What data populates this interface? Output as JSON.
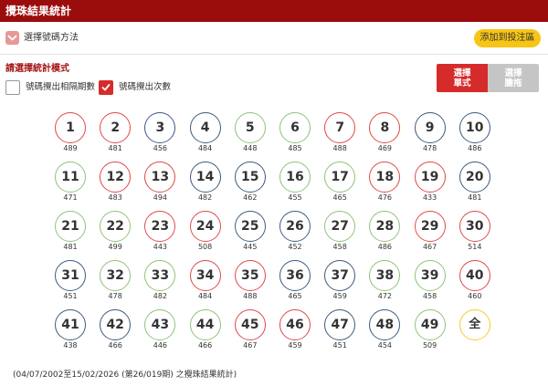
{
  "header": {
    "title": "攪珠結果統計"
  },
  "method": {
    "label": "選擇號碼方法",
    "add_button": "添加到投注區"
  },
  "mode": {
    "title": "請選擇統計模式",
    "options": [
      {
        "label": "號碼攪出相隔期數",
        "checked": false
      },
      {
        "label": "號碼攪出次數",
        "checked": true
      }
    ]
  },
  "tabs": [
    {
      "line1": "選擇",
      "line2": "單式",
      "active": true
    },
    {
      "line1": "選擇",
      "line2": "膽拖",
      "active": false
    }
  ],
  "colors": {
    "red": "#e04848",
    "blue": "#3d5a80",
    "green": "#8fc27a",
    "yellow": "#f5cc2a",
    "header": "#9b0c0c"
  },
  "balls": [
    {
      "num": "1",
      "count": "489",
      "color": "red"
    },
    {
      "num": "2",
      "count": "481",
      "color": "red"
    },
    {
      "num": "3",
      "count": "456",
      "color": "blue"
    },
    {
      "num": "4",
      "count": "484",
      "color": "blue"
    },
    {
      "num": "5",
      "count": "448",
      "color": "green"
    },
    {
      "num": "6",
      "count": "485",
      "color": "green"
    },
    {
      "num": "7",
      "count": "488",
      "color": "red"
    },
    {
      "num": "8",
      "count": "469",
      "color": "red"
    },
    {
      "num": "9",
      "count": "478",
      "color": "blue"
    },
    {
      "num": "10",
      "count": "486",
      "color": "blue"
    },
    {
      "num": "11",
      "count": "471",
      "color": "green"
    },
    {
      "num": "12",
      "count": "483",
      "color": "red"
    },
    {
      "num": "13",
      "count": "494",
      "color": "red"
    },
    {
      "num": "14",
      "count": "482",
      "color": "blue"
    },
    {
      "num": "15",
      "count": "462",
      "color": "blue"
    },
    {
      "num": "16",
      "count": "455",
      "color": "green"
    },
    {
      "num": "17",
      "count": "465",
      "color": "green"
    },
    {
      "num": "18",
      "count": "476",
      "color": "red"
    },
    {
      "num": "19",
      "count": "433",
      "color": "red"
    },
    {
      "num": "20",
      "count": "481",
      "color": "blue"
    },
    {
      "num": "21",
      "count": "481",
      "color": "green"
    },
    {
      "num": "22",
      "count": "499",
      "color": "green"
    },
    {
      "num": "23",
      "count": "443",
      "color": "red"
    },
    {
      "num": "24",
      "count": "508",
      "color": "red"
    },
    {
      "num": "25",
      "count": "445",
      "color": "blue"
    },
    {
      "num": "26",
      "count": "452",
      "color": "blue"
    },
    {
      "num": "27",
      "count": "458",
      "color": "green"
    },
    {
      "num": "28",
      "count": "486",
      "color": "green"
    },
    {
      "num": "29",
      "count": "467",
      "color": "red"
    },
    {
      "num": "30",
      "count": "514",
      "color": "red"
    },
    {
      "num": "31",
      "count": "451",
      "color": "blue"
    },
    {
      "num": "32",
      "count": "478",
      "color": "green"
    },
    {
      "num": "33",
      "count": "482",
      "color": "green"
    },
    {
      "num": "34",
      "count": "484",
      "color": "red"
    },
    {
      "num": "35",
      "count": "488",
      "color": "red"
    },
    {
      "num": "36",
      "count": "465",
      "color": "blue"
    },
    {
      "num": "37",
      "count": "459",
      "color": "blue"
    },
    {
      "num": "38",
      "count": "472",
      "color": "green"
    },
    {
      "num": "39",
      "count": "458",
      "color": "green"
    },
    {
      "num": "40",
      "count": "460",
      "color": "red"
    },
    {
      "num": "41",
      "count": "438",
      "color": "blue"
    },
    {
      "num": "42",
      "count": "466",
      "color": "blue"
    },
    {
      "num": "43",
      "count": "446",
      "color": "green"
    },
    {
      "num": "44",
      "count": "466",
      "color": "green"
    },
    {
      "num": "45",
      "count": "467",
      "color": "red"
    },
    {
      "num": "46",
      "count": "459",
      "color": "red"
    },
    {
      "num": "47",
      "count": "451",
      "color": "blue"
    },
    {
      "num": "48",
      "count": "454",
      "color": "blue"
    },
    {
      "num": "49",
      "count": "509",
      "color": "green"
    },
    {
      "num": "全",
      "count": "",
      "color": "yellow"
    }
  ],
  "footer": {
    "text": "(04/07/2002至15/02/2026 (第26/019期) 之攪珠結果統計)"
  }
}
